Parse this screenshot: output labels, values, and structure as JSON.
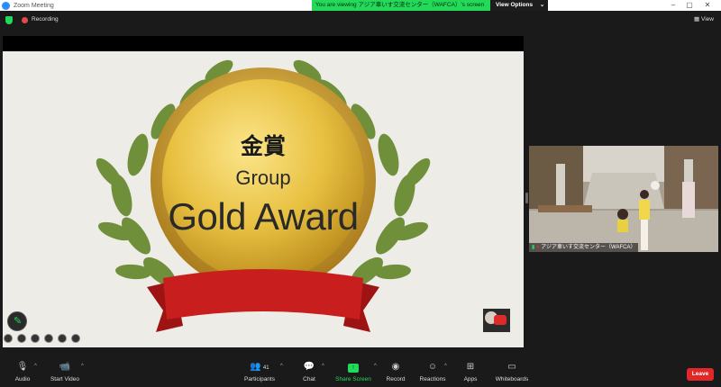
{
  "window": {
    "title": "Zoom Meeting",
    "viewing_banner": "You are viewing アジア車いす交流センター（WAFCA）'s screen",
    "view_options_label": "View Options",
    "controls": [
      "minimize-icon",
      "maximize-icon",
      "close-icon"
    ]
  },
  "status": {
    "recording_label": "Recording",
    "view_label": "View"
  },
  "slide": {
    "japanese_title": "金賞",
    "group_text": "Group",
    "award_text": "Gold Award",
    "colors": {
      "medal": "#e8c040",
      "laurel": "#6f8f3a",
      "ribbon": "#c81e1e",
      "background": "#eeece6"
    }
  },
  "participant_video": {
    "name": "アジア車いす交流センター（WAFCA）"
  },
  "toolbar": {
    "audio": "Audio",
    "start_video": "Start Video",
    "participants": "Participants",
    "participants_count": "41",
    "chat": "Chat",
    "share_screen": "Share Screen",
    "record": "Record",
    "reactions": "Reactions",
    "apps": "Apps",
    "whiteboards": "Whiteboards",
    "leave": "Leave"
  },
  "accent_colors": {
    "green": "#23d959",
    "red": "#e02828",
    "blue": "#2d8cff"
  }
}
